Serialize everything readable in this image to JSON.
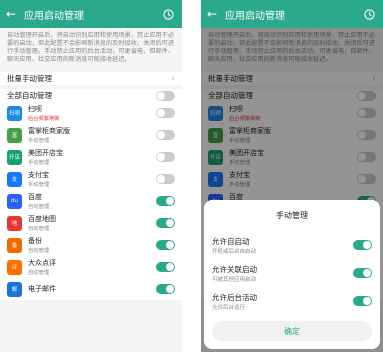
{
  "header": {
    "title": "应用启动管理",
    "back_icon": "arrow-left-icon",
    "history_icon": "clock-icon"
  },
  "description": "自动管理开启后，将自动识别应用和使用场景，禁止应用不必要的启动，但此配置不会影响新消息的及时接收。关闭后可进行手动管理。手动禁止应用的后台活动，可更省电，但邮件、聊天应用、社交应用的新消息可能接收延迟。",
  "batch_manage": "批量手动管理",
  "all_auto": "全部自动管理",
  "apps": [
    {
      "name": "扫呗",
      "sub": "后台频繁刷新",
      "sub_color": "#e53935",
      "icon_color": "#1e88e5",
      "icon_text": "扫呗",
      "toggle": "off"
    },
    {
      "name": "富掌柜商家版",
      "sub": "手动管理",
      "sub_color": "#888888",
      "icon_color": "#43a047",
      "icon_text": "富",
      "toggle": "off"
    },
    {
      "name": "美团开店宝",
      "sub": "手动管理",
      "sub_color": "#888888",
      "icon_color": "#1aa06d",
      "icon_text": "开店",
      "toggle": "off"
    },
    {
      "name": "支付宝",
      "sub": "手动管理",
      "sub_color": "#888888",
      "icon_color": "#1677ff",
      "icon_text": "支",
      "toggle": "off"
    },
    {
      "name": "百度",
      "sub": "自动管理",
      "sub_color": "#888888",
      "icon_color": "#2962ff",
      "icon_text": "du",
      "toggle": "on"
    },
    {
      "name": "百度地图",
      "sub": "自动管理",
      "sub_color": "#888888",
      "icon_color": "#e53935",
      "icon_text": "地",
      "toggle": "on"
    },
    {
      "name": "备份",
      "sub": "自动管理",
      "sub_color": "#888888",
      "icon_color": "#ef6c00",
      "icon_text": "备",
      "toggle": "on"
    },
    {
      "name": "大众点评",
      "sub": "自动管理",
      "sub_color": "#888888",
      "icon_color": "#ff6f00",
      "icon_text": "评",
      "toggle": "on"
    },
    {
      "name": "电子邮件",
      "sub": "",
      "sub_color": "#888888",
      "icon_color": "#1976d2",
      "icon_text": "邮",
      "toggle": "on"
    }
  ],
  "dialog": {
    "title": "手动管理",
    "options": [
      {
        "label": "允许自启动",
        "sub": "开机或后台自启动",
        "toggle": "on"
      },
      {
        "label": "允许关联启动",
        "sub": "可被其他应用启动",
        "toggle": "on"
      },
      {
        "label": "允许后台活动",
        "sub": "允许后台运行",
        "toggle": "on"
      }
    ],
    "confirm": "确定"
  },
  "colors": {
    "accent": "#2aa98b"
  }
}
